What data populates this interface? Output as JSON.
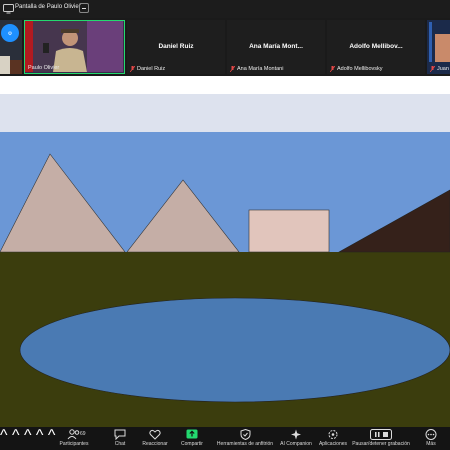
{
  "window": {
    "title": "Pantalla de Paulo Olivier"
  },
  "participants": [
    {
      "name": "Paulo Olivier",
      "tag": "Paulo Olivier",
      "muted": false,
      "active_speaker": true
    },
    {
      "name": "Daniel Ruiz",
      "tag": "Daniel Ruiz",
      "muted": true
    },
    {
      "name": "Ana María Mont...",
      "tag": "Ana María Montani",
      "muted": true
    },
    {
      "name": "Adolfo Mellibov...",
      "tag": "Adolfo Mellibovsky",
      "muted": true
    },
    {
      "name": "",
      "tag": "Juan",
      "muted": true
    }
  ],
  "toolbar": {
    "participants_label": "Participantes",
    "participants_count": "69",
    "chat_label": "Chat",
    "react_label": "Reaccionar",
    "share_label": "Compartir",
    "host_tools_label": "Herramientas de anfitrión",
    "companion_label": "AI Companion",
    "apps_label": "Aplicaciones",
    "record_label": "Pausar/detener grabación",
    "more_label": "Más"
  },
  "colors": {
    "sky": "#6b97d6",
    "sky_band": "#dde2ee",
    "ground": "#3b3d0d",
    "pyramid": "#c5aea6",
    "building": "#e1c5bc",
    "mountain": "#35211a",
    "lake": "#4a7ab3",
    "active_border": "#23d96f"
  },
  "icons": {
    "title_icon": "screen-share-icon",
    "minimize": "minimize-icon"
  }
}
